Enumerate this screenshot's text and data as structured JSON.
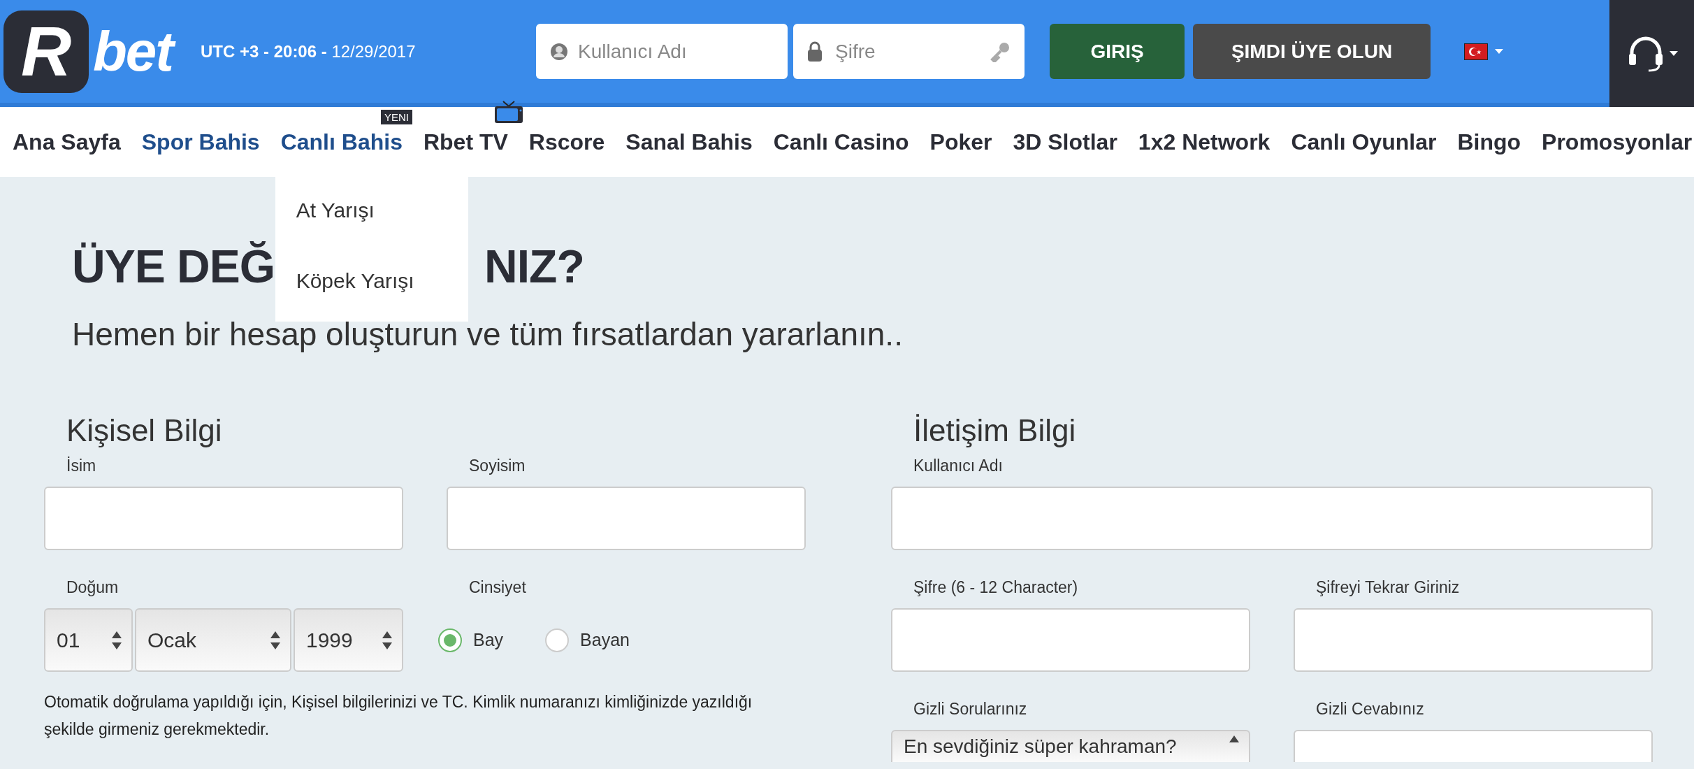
{
  "header": {
    "logo": {
      "mark": "R",
      "text": "bet"
    },
    "clock": "**UTC +3 - 20:06 -** 12/29/2017",
    "login": {
      "username": {
        "placeholder": "Kullanıcı Adı"
      },
      "password": {
        "placeholder": "Şifre"
      },
      "login_button": "GIRIŞ",
      "signup_button": "ŞIMDI ÜYE OLUN"
    }
  },
  "nav": [
    {
      "label": "Ana Sayfa",
      "active": false
    },
    {
      "label": "Spor Bahis",
      "active": true
    },
    {
      "label": "Canlı Bahis",
      "active": true,
      "badge": "YENI",
      "expanded": true,
      "submenu": [
        "At Yarışı",
        "Köpek Yarışı"
      ]
    },
    {
      "label": "Rbet TV",
      "active": false,
      "kind": "tv"
    },
    {
      "label": "Rscore",
      "active": false
    },
    {
      "label": "Sanal Bahis",
      "active": false
    },
    {
      "label": "Canlı Casino",
      "active": false
    },
    {
      "label": "Poker",
      "active": false
    },
    {
      "label": "3D Slotlar",
      "active": false
    },
    {
      "label": "1x2 Network",
      "active": false
    },
    {
      "label": "Canlı Oyunlar",
      "active": false
    },
    {
      "label": "Bingo",
      "active": false
    },
    {
      "label": "Promosyonlar",
      "active": false
    }
  ],
  "heading_parts": [
    "ÜYE DEĞ",
    "NIZ?"
  ],
  "subtitle": "Hemen bir hesap oluşturun ve tüm fırsatlardan yararlanın..",
  "personal": {
    "title": "Kişisel Bilgi",
    "name": {
      "label": "İsim"
    },
    "surname": {
      "label": "Soyisim"
    },
    "birth": {
      "label": "Doğum",
      "day": "01",
      "month": "Ocak",
      "year": "1999"
    },
    "gender": {
      "label": "Cinsiyet",
      "options": [
        {
          "label": "Bay",
          "selected": true
        },
        {
          "label": "Bayan",
          "selected": false
        }
      ]
    },
    "note": "Otomatik doğrulama yapıldığı için, Kişisel bilgilerinizi ve TC. Kimlik numaranızı kimliğinizde yazıldığı şekilde girmeniz gerekmektedir."
  },
  "contact": {
    "title": "İletişim Bilgi",
    "username": {
      "label": "Kullanıcı Adı"
    },
    "password": {
      "label": "Şifre (6 - 12 Character)"
    },
    "password_repeat": {
      "label": "Şifreyi Tekrar Giriniz"
    },
    "question": {
      "label": "Gizli Sorularınız",
      "value": "En sevdiğiniz süper kahraman?"
    },
    "answer": {
      "label": "Gizli Cevabınız"
    }
  }
}
